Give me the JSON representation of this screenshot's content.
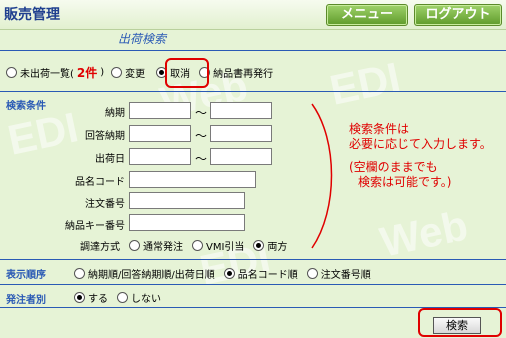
{
  "header": {
    "title": "販売管理",
    "menu_label": "メニュー",
    "logout_label": "ログアウト",
    "subtitle": "出荷検索"
  },
  "mode_options": [
    {
      "label": "未出荷一覧(",
      "count": "2件",
      "suffix": ")",
      "selected": false
    },
    {
      "label": "変更",
      "selected": false
    },
    {
      "label": "取消",
      "selected": true
    },
    {
      "label": "納品書再発行",
      "selected": false
    }
  ],
  "conditions": {
    "section_label": "検索条件",
    "fields": [
      {
        "label": "納期",
        "range": true,
        "value_from": "",
        "value_to": ""
      },
      {
        "label": "回答納期",
        "range": true,
        "value_from": "",
        "value_to": ""
      },
      {
        "label": "出荷日",
        "range": true,
        "value_from": "",
        "value_to": ""
      },
      {
        "label": "品名コード",
        "range": false,
        "value": ""
      },
      {
        "label": "注文番号",
        "range": false,
        "value": ""
      },
      {
        "label": "納品キー番号",
        "range": false,
        "value": ""
      }
    ],
    "range_separator": "～",
    "procurement": {
      "label": "調達方式",
      "options": [
        {
          "label": "通常発注",
          "selected": false
        },
        {
          "label": "VMI引当",
          "selected": false
        },
        {
          "label": "両方",
          "selected": true
        }
      ]
    }
  },
  "note": {
    "line1": "検索条件は",
    "line2": "必要に応じて入力します。",
    "line3": "(空欄のままでも",
    "line4": "検索は可能です。)"
  },
  "sort": {
    "label": "表示順序",
    "options": [
      {
        "label": "納期順/回答納期順/出荷日順",
        "selected": false
      },
      {
        "label": "品名コード順",
        "selected": true
      },
      {
        "label": "注文番号順",
        "selected": false
      }
    ]
  },
  "orderer": {
    "label": "発注者別",
    "options": [
      {
        "label": "する",
        "selected": true
      },
      {
        "label": "しない",
        "selected": false
      }
    ]
  },
  "search_button_label": "検索",
  "colors": {
    "accent": "#2a5ab5",
    "annotation": "#e00000",
    "background": "#e6f3d6"
  }
}
